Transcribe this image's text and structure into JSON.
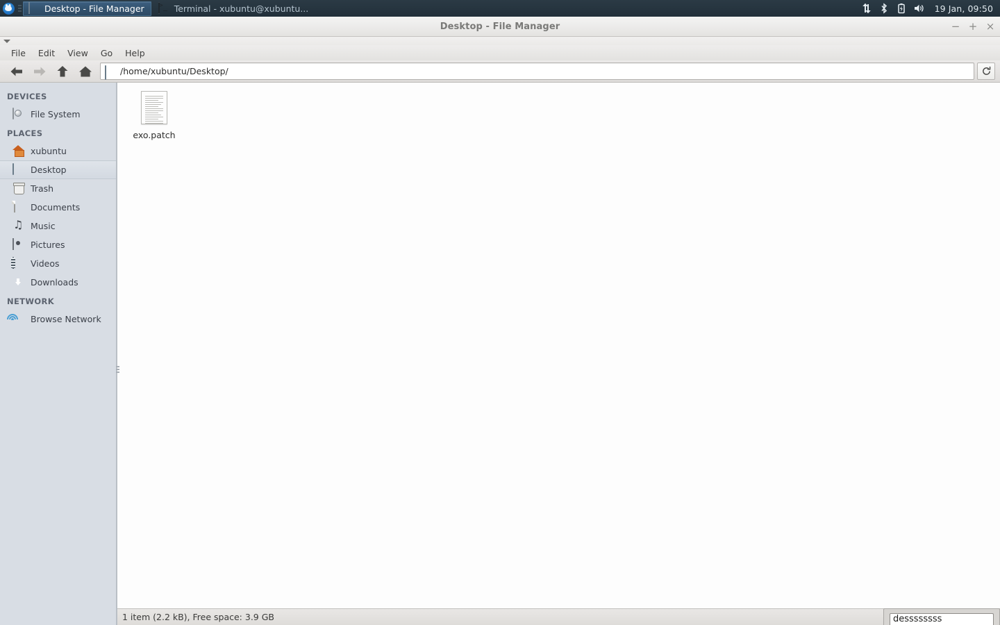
{
  "panel": {
    "menu_icon": "xubuntu-mouse-logo",
    "tasks": [
      {
        "label": "Desktop - File Manager",
        "icon": "file-manager-icon",
        "active": true
      },
      {
        "label": "Terminal - xubuntu@xubuntu...",
        "icon": "terminal-icon",
        "active": false
      }
    ],
    "tray": [
      {
        "name": "network-updown-icon"
      },
      {
        "name": "bluetooth-icon"
      },
      {
        "name": "battery-charging-icon"
      },
      {
        "name": "volume-icon"
      }
    ],
    "clock": "19 Jan, 09:50"
  },
  "window": {
    "title": "Desktop - File Manager",
    "controls": {
      "minimize": "−",
      "maximize": "+",
      "close": "×"
    }
  },
  "menubar": {
    "items": [
      {
        "label": "File"
      },
      {
        "label": "Edit"
      },
      {
        "label": "View"
      },
      {
        "label": "Go"
      },
      {
        "label": "Help"
      }
    ]
  },
  "toolbar": {
    "back": "back-icon",
    "forward": "forward-icon",
    "up": "up-icon",
    "home": "home-icon",
    "path": "/home/xubuntu/Desktop/",
    "path_icon": "desktop-folder-icon",
    "reload": "reload-icon"
  },
  "sidebar": {
    "groups": [
      {
        "title": "DEVICES",
        "items": [
          {
            "label": "File System",
            "icon": "harddisk-icon",
            "selected": false
          }
        ]
      },
      {
        "title": "PLACES",
        "items": [
          {
            "label": "xubuntu",
            "icon": "home-icon",
            "selected": false
          },
          {
            "label": "Desktop",
            "icon": "desktop-icon",
            "selected": true
          },
          {
            "label": "Trash",
            "icon": "trash-icon",
            "selected": false
          },
          {
            "label": "Documents",
            "icon": "document-icon",
            "selected": false
          },
          {
            "label": "Music",
            "icon": "music-icon",
            "selected": false
          },
          {
            "label": "Pictures",
            "icon": "pictures-icon",
            "selected": false
          },
          {
            "label": "Videos",
            "icon": "video-icon",
            "selected": false
          },
          {
            "label": "Downloads",
            "icon": "download-icon",
            "selected": false
          }
        ]
      },
      {
        "title": "NETWORK",
        "items": [
          {
            "label": "Browse Network",
            "icon": "network-icon",
            "selected": false
          }
        ]
      }
    ]
  },
  "main": {
    "files": [
      {
        "name": "exo.patch",
        "icon": "text-document-icon"
      }
    ]
  },
  "statusbar": {
    "text": "1 item (2.2 kB), Free space: 3.9 GB"
  },
  "popup": {
    "input_value": "dessssssss"
  },
  "colors": {
    "panel_bg": "#22303a",
    "task_active_bg": "#33536f",
    "sidebar_bg": "#d8dde4",
    "window_bg": "#f2f1f0",
    "accent": "#4a9fd4"
  }
}
